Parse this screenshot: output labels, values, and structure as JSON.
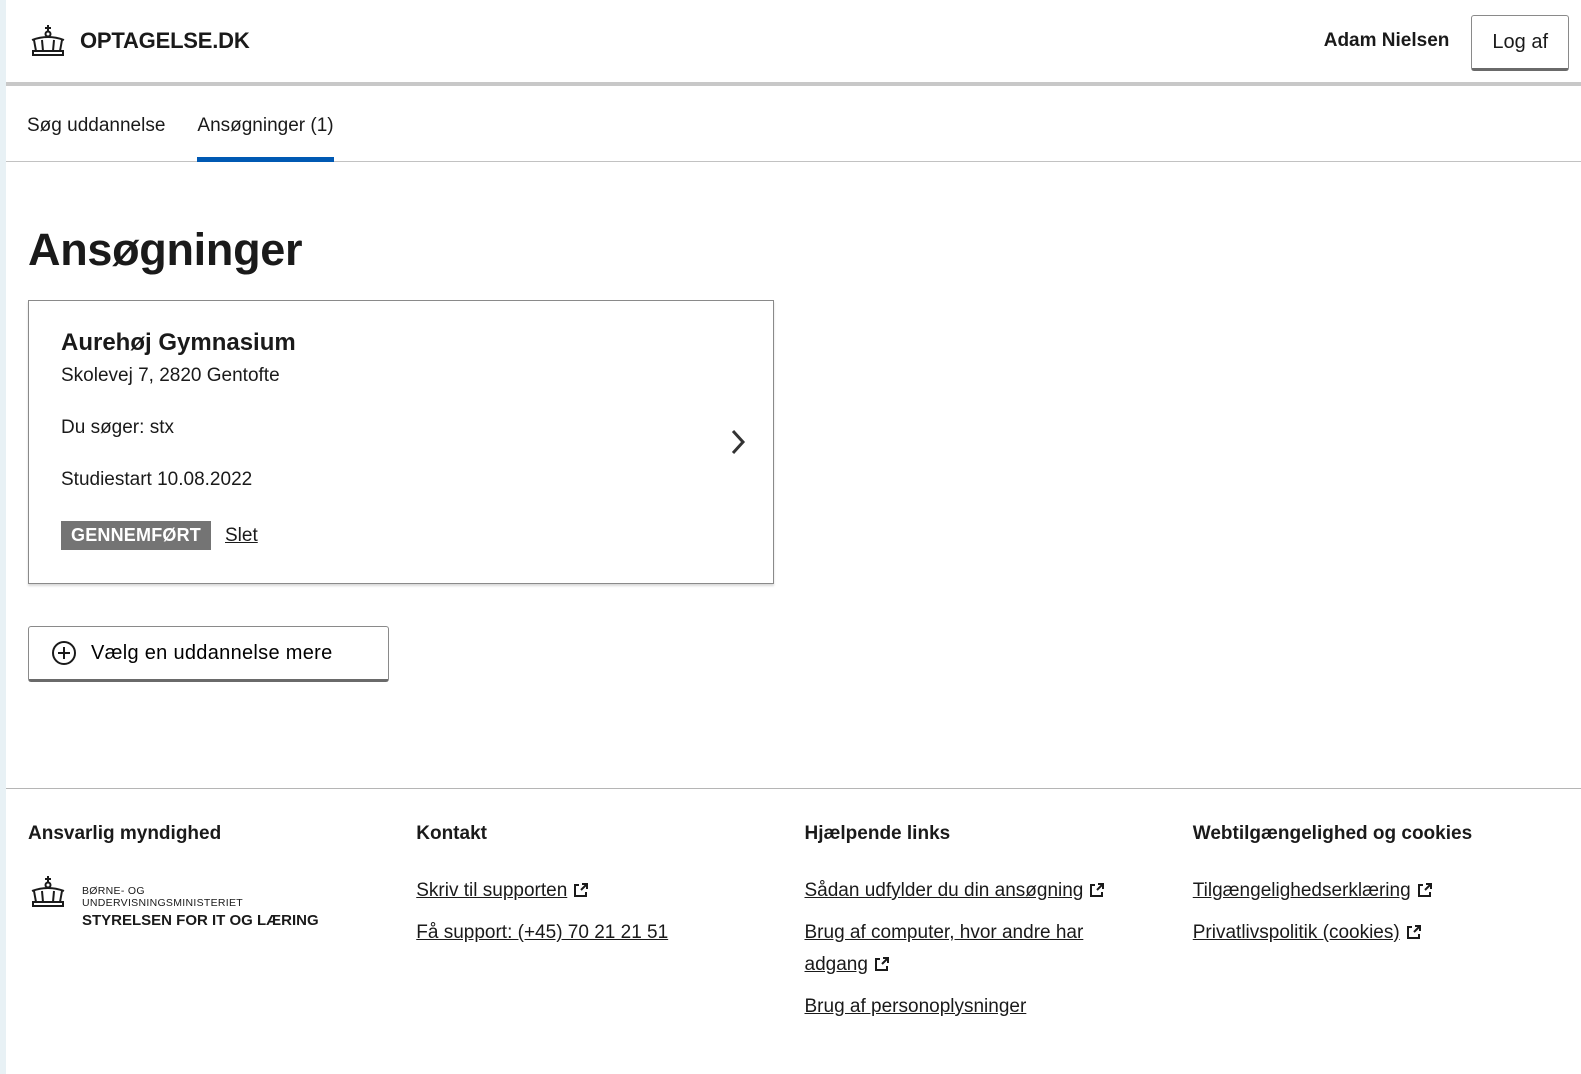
{
  "header": {
    "brand": "OPTAGELSE.DK",
    "user_name": "Adam Nielsen",
    "logout_label": "Log af"
  },
  "tabs": [
    {
      "label": "Søg uddannelse",
      "active": false
    },
    {
      "label": "Ansøgninger (1)",
      "active": true
    }
  ],
  "main": {
    "title": "Ansøgninger",
    "application": {
      "school": "Aurehøj Gymnasium",
      "address": "Skolevej 7, 2820 Gentofte",
      "applying": "Du søger: stx",
      "start": "Studiestart 10.08.2022",
      "status": "GENNEMFØRT",
      "delete_label": "Slet"
    },
    "add_button_label": "Vælg en uddannelse mere"
  },
  "footer": {
    "authority": {
      "heading": "Ansvarlig myndighed",
      "ministry_line1": "BØRNE- OG",
      "ministry_line2": "UNDERVISNINGSMINISTERIET",
      "agency": "STYRELSEN FOR IT OG LÆRING"
    },
    "contact": {
      "heading": "Kontakt",
      "links": [
        "Skriv til supporten",
        "Få support: (+45) 70 21 21 51"
      ]
    },
    "help": {
      "heading": "Hjælpende links",
      "links": [
        "Sådan udfylder du din ansøgning",
        "Brug af computer, hvor andre har adgang",
        "Brug af personoplysninger"
      ]
    },
    "accessibility": {
      "heading": "Webtilgængelighed og cookies",
      "links": [
        "Tilgængelighedserklæring",
        "Privatlivspolitik (cookies)"
      ]
    }
  },
  "colors": {
    "accent": "#0059b3",
    "badge": "#747474",
    "outer_background": "#e8f1f5"
  },
  "icons": [
    "crown-icon",
    "chevron-right-icon",
    "plus-circle-icon",
    "external-link-icon"
  ]
}
